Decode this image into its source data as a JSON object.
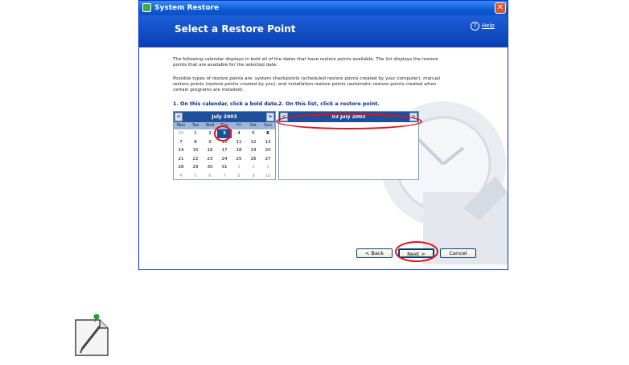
{
  "window": {
    "title": "System Restore",
    "close_glyph": "✕"
  },
  "header": {
    "title": "Select a Restore Point",
    "help_label": "Help",
    "help_glyph": "?"
  },
  "content": {
    "intro": "The following calendar displays in bold all of the dates that have restore points available. The list displays the restore points that are available for the selected date.",
    "types": "Possible types of restore points are: system checkpoints (scheduled restore points created by your computer), manual restore points (restore points created by you), and installation restore points (automatic restore points created when certain programs are installed).",
    "step1": "1. On this calendar, click a bold date.",
    "step2": "2. On this list, click a restore point."
  },
  "calendar": {
    "month": "July 2003",
    "prev": "<",
    "next": ">",
    "day_names": [
      "Mon",
      "Tue",
      "Wed",
      "Thu",
      "Fri",
      "Sat",
      "Sun"
    ],
    "weeks": [
      [
        "30",
        "1",
        "2",
        "3",
        "4",
        "5",
        "6"
      ],
      [
        "7",
        "8",
        "9",
        "10",
        "11",
        "12",
        "13"
      ],
      [
        "14",
        "15",
        "16",
        "17",
        "18",
        "19",
        "20"
      ],
      [
        "21",
        "22",
        "23",
        "24",
        "25",
        "26",
        "27"
      ],
      [
        "28",
        "29",
        "30",
        "31",
        "1",
        "2",
        "3"
      ],
      [
        "4",
        "5",
        "6",
        "7",
        "8",
        "9",
        "10"
      ]
    ],
    "selected": "3"
  },
  "restore_list": {
    "date": "03 July 2003",
    "prev": "<",
    "next": ">"
  },
  "buttons": {
    "back": "< Back",
    "next": "Next >",
    "cancel": "Cancel"
  },
  "colors": {
    "accent": "#1d4f9a",
    "highlight": "#e0101a"
  },
  "icons": {
    "note": "pencil-note-icon"
  }
}
